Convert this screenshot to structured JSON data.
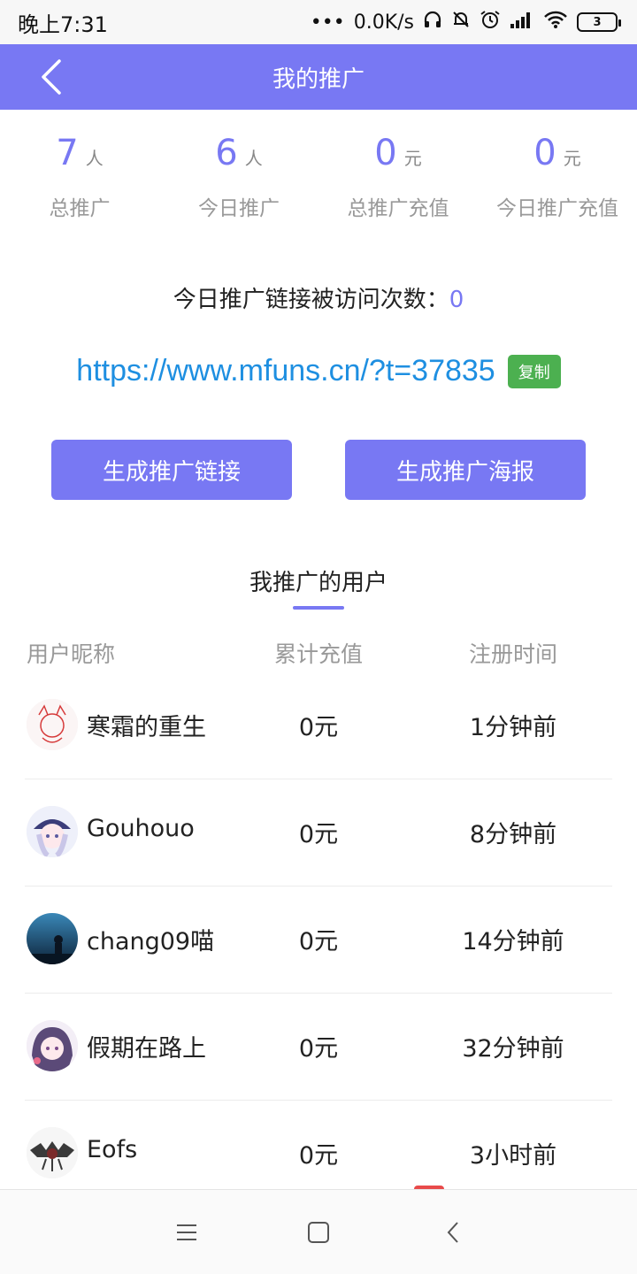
{
  "status_bar": {
    "time": "晚上7:31",
    "network_speed": "0.0K/s",
    "battery": "3"
  },
  "header": {
    "title": "我的推广"
  },
  "stats": [
    {
      "value": "7",
      "unit": "人",
      "label": "总推广"
    },
    {
      "value": "6",
      "unit": "人",
      "label": "今日推广"
    },
    {
      "value": "0",
      "unit": "元",
      "label": "总推广充值"
    },
    {
      "value": "0",
      "unit": "元",
      "label": "今日推广充值"
    }
  ],
  "visit": {
    "label": "今日推广链接被访问次数：",
    "count": "0"
  },
  "link": {
    "url": "https://www.mfuns.cn/?t=37835",
    "copy_label": "复制"
  },
  "buttons": {
    "generate_link": "生成推广链接",
    "generate_poster": "生成推广海报"
  },
  "section": {
    "title": "我推广的用户"
  },
  "table": {
    "headers": [
      "用户昵称",
      "累计充值",
      "注册时间"
    ],
    "rows": [
      {
        "nickname": "寒霜的重生",
        "amount": "0元",
        "time": "1分钟前"
      },
      {
        "nickname": "Gouhouo",
        "amount": "0元",
        "time": "8分钟前"
      },
      {
        "nickname": "chang09喵",
        "amount": "0元",
        "time": "14分钟前"
      },
      {
        "nickname": "假期在路上",
        "amount": "0元",
        "time": "32分钟前"
      },
      {
        "nickname": "Eofs",
        "amount": "0元",
        "time": "3小时前"
      }
    ]
  },
  "colors": {
    "accent": "#7878f3",
    "link": "#1e8fe1",
    "copy_button": "#4cb050"
  },
  "icons": {
    "back": "chevron-left-icon",
    "menu": "menu-icon",
    "home": "home-square-icon",
    "nav_back": "nav-back-icon"
  }
}
